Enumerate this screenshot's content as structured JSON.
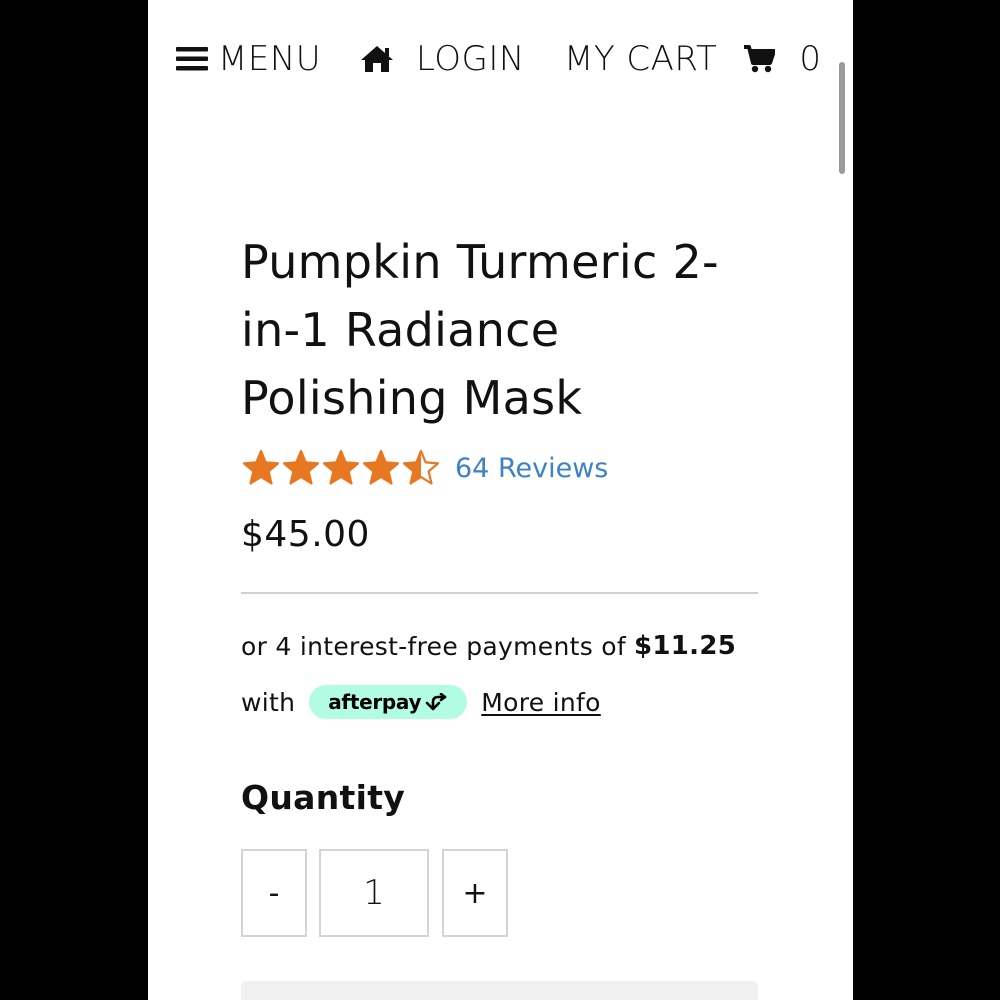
{
  "nav": {
    "menu_label": "MENU",
    "login_label": "LOGIN",
    "cart_label": "MY CART",
    "cart_count": "0",
    "icons": [
      "hamburger-icon",
      "home-icon",
      "cart-icon"
    ]
  },
  "product": {
    "title": "Pumpkin Turmeric 2-in-1 Radiance Polishing Mask",
    "rating": 4.5,
    "rating_max": 5,
    "reviews_label": "64 Reviews",
    "price": "$45.00"
  },
  "afterpay": {
    "installment_text": "or 4 interest-free payments of",
    "installment_amount": "$11.25",
    "with_text": "with",
    "badge_label": "afterpay",
    "more_info": "More info"
  },
  "quantity": {
    "label": "Quantity",
    "minus_label": "-",
    "value": "1",
    "plus_label": "+"
  },
  "colors": {
    "star": "#e87722",
    "link": "#3d82c6",
    "afterpay_mint": "#b2fce4",
    "background_outside": "#000000"
  }
}
